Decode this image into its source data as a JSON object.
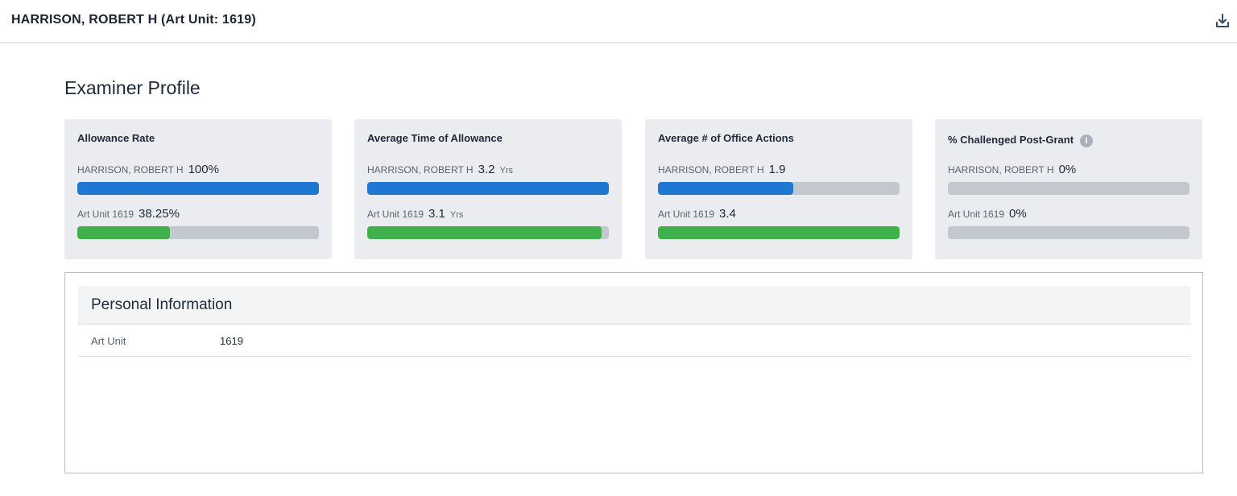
{
  "header": {
    "title": "HARRISON, ROBERT H (Art Unit: 1619)",
    "download_icon": "download-icon"
  },
  "section_title": "Examiner Profile",
  "colors": {
    "examiner_bar": "#1e77d2",
    "art_unit_bar": "#3fb14b",
    "track": "#c3c8ce"
  },
  "cards": [
    {
      "title": "Allowance Rate",
      "examiner": {
        "label": "HARRISON, ROBERT H",
        "value": "100%",
        "unit": "",
        "fill": 1.0
      },
      "art_unit": {
        "label": "Art Unit 1619",
        "value": "38.25%",
        "unit": "",
        "fill": 0.3825
      }
    },
    {
      "title": "Average Time of Allowance",
      "examiner": {
        "label": "HARRISON, ROBERT H",
        "value": "3.2",
        "unit": "Yrs",
        "fill": 1.0
      },
      "art_unit": {
        "label": "Art Unit 1619",
        "value": "3.1",
        "unit": "Yrs",
        "fill": 0.97
      }
    },
    {
      "title": "Average # of Office Actions",
      "examiner": {
        "label": "HARRISON, ROBERT H",
        "value": "1.9",
        "unit": "",
        "fill": 0.559
      },
      "art_unit": {
        "label": "Art Unit 1619",
        "value": "3.4",
        "unit": "",
        "fill": 1.0
      }
    },
    {
      "title": "% Challenged Post-Grant",
      "info_icon": "info-icon",
      "examiner": {
        "label": "HARRISON, ROBERT H",
        "value": "0%",
        "unit": "",
        "fill": 0.0
      },
      "art_unit": {
        "label": "Art Unit 1619",
        "value": "0%",
        "unit": "",
        "fill": 0.0
      }
    }
  ],
  "personal_info": {
    "title": "Personal Information",
    "rows": [
      {
        "key": "Art Unit",
        "value": "1619"
      }
    ]
  }
}
